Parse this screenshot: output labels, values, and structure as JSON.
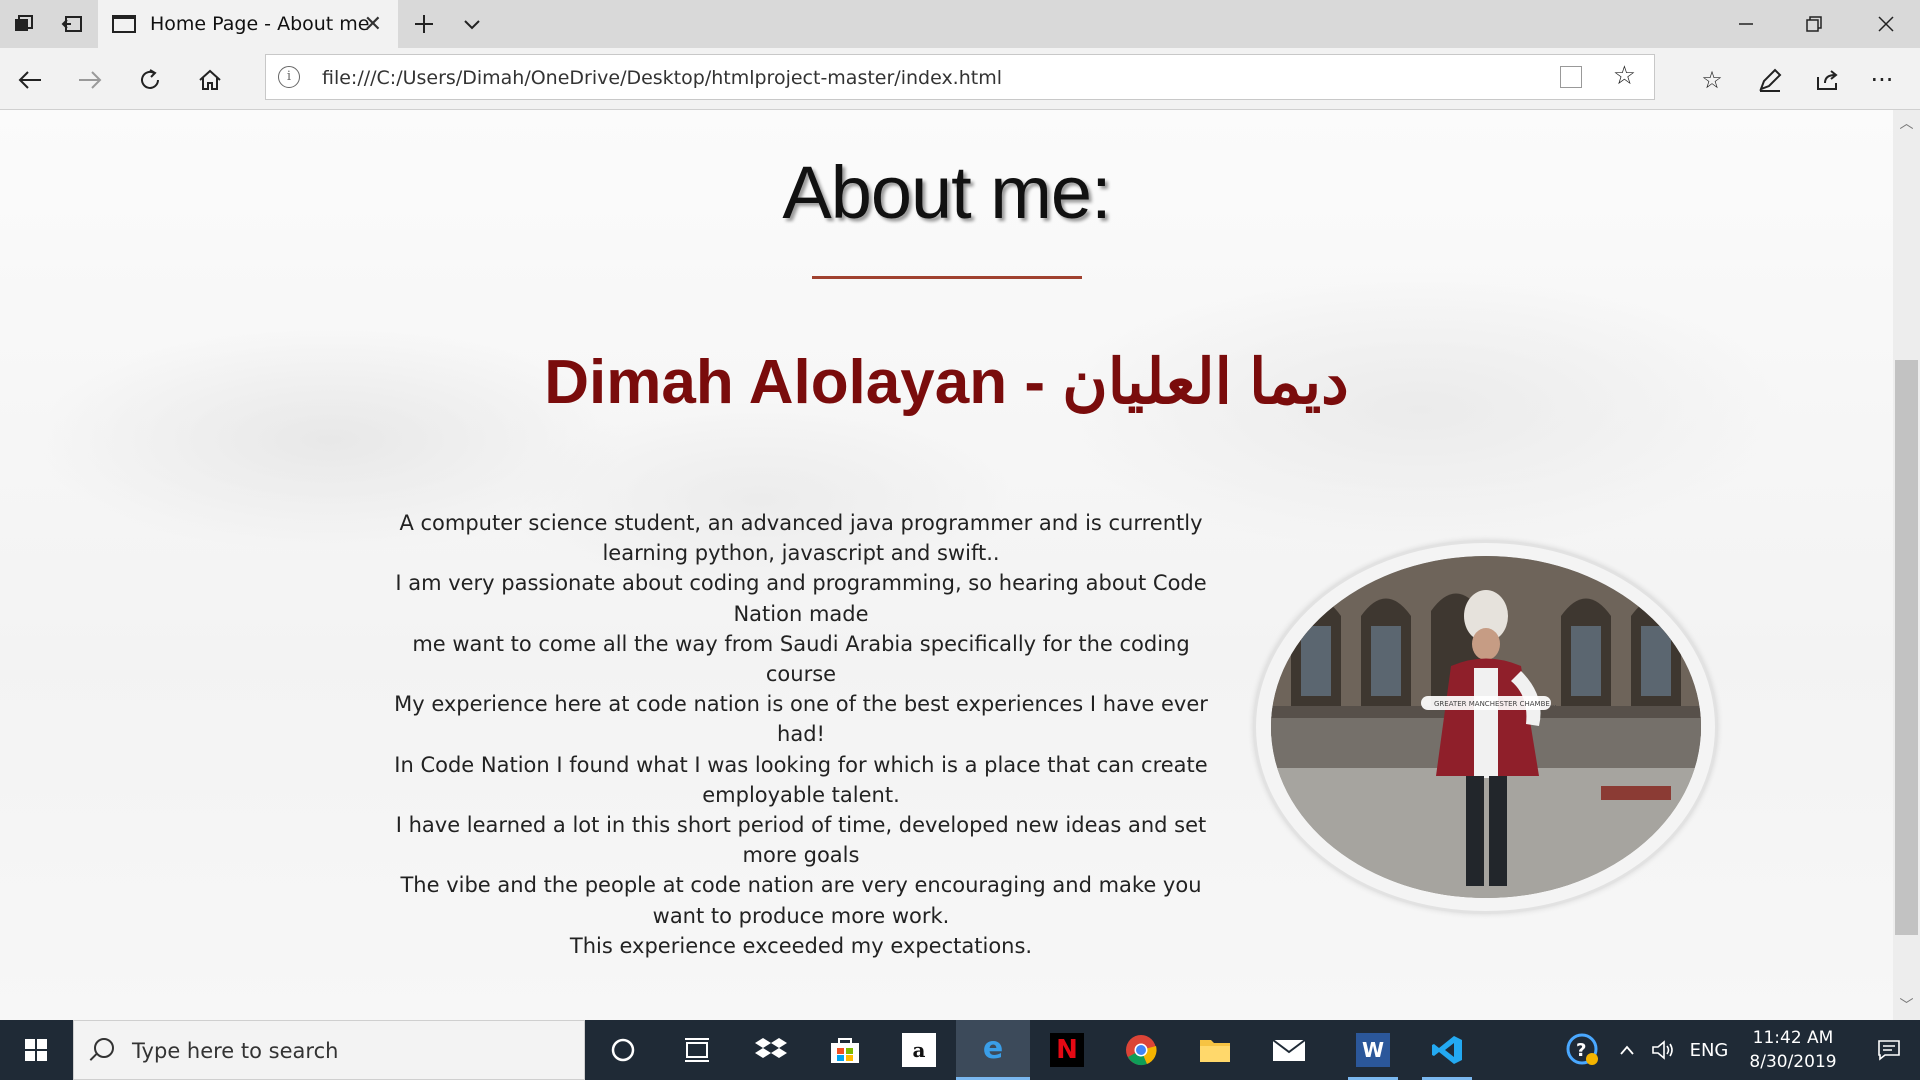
{
  "browser": {
    "tab_title": "Home Page - About me",
    "url": "file:///C:/Users/Dimah/OneDrive/Desktop/htmlproject-master/index.html"
  },
  "page": {
    "heading": "About me:",
    "name": "Dimah Alolayan - ديما العليان",
    "bio_lines": [
      "A computer science student, an advanced java programmer and is currently learning python, javascript and swift..",
      "I am very passionate about coding and programming, so hearing about Code Nation made",
      "me want to come all the way from Saudi Arabia specifically for the coding course",
      "My experience here at code nation is one of the best experiences I have ever had!",
      "In Code Nation I found what I was looking for which is a place that can create employable talent.",
      "I have learned a lot in this short period of time, developed new ideas and set more goals",
      "The vibe and the people at code nation are very encouraging and make you want to produce more work.",
      "This experience exceeded my expectations."
    ],
    "photo_caption": "GREATER MANCHESTER CHAMBE..."
  },
  "taskbar": {
    "search_placeholder": "Type here to search",
    "language": "ENG",
    "time": "11:42 AM",
    "date": "8/30/2019",
    "apps": [
      "cortana-icon",
      "task-view-icon",
      "dropbox-icon",
      "store-icon",
      "amazon-icon",
      "edge-icon",
      "netflix-icon",
      "chrome-icon",
      "file-explorer-icon",
      "mail-icon",
      "word-icon",
      "vscode-icon"
    ]
  },
  "colors": {
    "name_color": "#7a0c0c",
    "rule_color": "#a0412f",
    "taskbar": "#1f2a36"
  }
}
